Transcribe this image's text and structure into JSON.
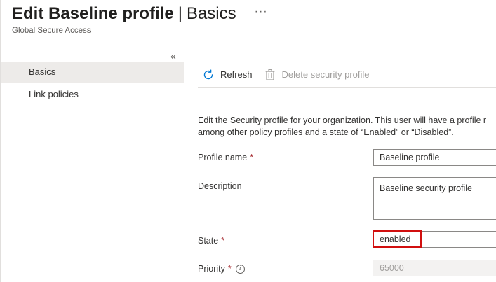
{
  "header": {
    "title": "Edit Baseline profile",
    "separator": "|",
    "section": "Basics",
    "more_icon": "more-horizontal-icon",
    "subtitle": "Global Secure Access"
  },
  "sidebar": {
    "collapse_icon": "double-chevron-left-icon",
    "items": [
      {
        "label": "Basics",
        "active": true
      },
      {
        "label": "Link policies",
        "active": false
      }
    ]
  },
  "toolbar": {
    "refresh_label": "Refresh",
    "delete_label": "Delete security profile"
  },
  "form": {
    "description_line1": "Edit the Security profile for your organization. This user will have a profile r",
    "description_line2": "among other policy profiles and a state of “Enabled” or “Disabled”.",
    "profile_name_label": "Profile name",
    "profile_name_value": "Baseline profile",
    "description_label": "Description",
    "description_value": "Baseline security profile",
    "state_label": "State",
    "state_value": "enabled",
    "priority_label": "Priority",
    "priority_value": "65000",
    "required_mark": "*"
  },
  "colors": {
    "accent": "#0078d4",
    "required": "#a4262c",
    "highlight": "#d10f0f",
    "active_nav": "#edebe9"
  }
}
